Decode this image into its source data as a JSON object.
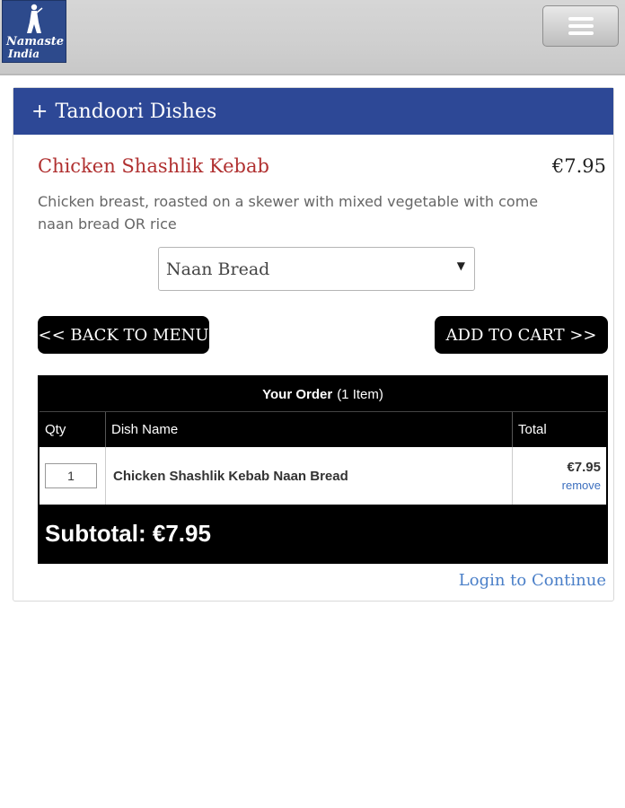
{
  "header": {
    "logo_line1": "Namaste",
    "logo_line2": "India"
  },
  "category": {
    "toggle_symbol": "+",
    "title": "Tandoori Dishes"
  },
  "item": {
    "name": "Chicken Shashlik Kebab",
    "price": "€7.95",
    "description": "Chicken breast, roasted on a skewer with mixed vegetable with come naan bread OR rice",
    "option_selected": "Naan Bread"
  },
  "buttons": {
    "back": "<< BACK TO MENU",
    "add_to_cart": "ADD TO CART >>"
  },
  "order": {
    "title": "Your Order",
    "count": "(1 Item)",
    "columns": [
      "Qty",
      "Dish Name",
      "Total"
    ],
    "rows": [
      {
        "qty": "1",
        "dish": "Chicken Shashlik Kebab Naan Bread",
        "total": "€7.95",
        "remove": "remove"
      }
    ],
    "subtotal": "Subtotal: €7.95"
  },
  "login_link": "Login to Continue",
  "colors": {
    "header_blue": "#2d4896",
    "item_name_red": "#b03030",
    "link_blue": "#4a7fc8"
  },
  "icons": [
    "menu-icon",
    "dropdown-caret-icon",
    "logo-figure-icon"
  ]
}
